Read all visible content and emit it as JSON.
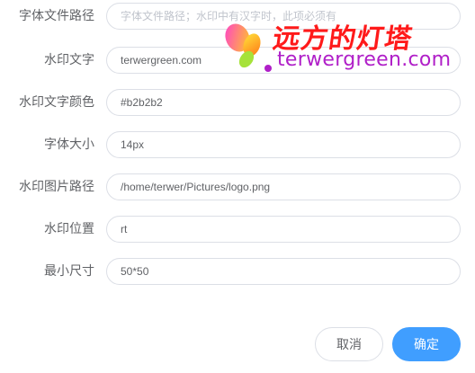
{
  "form": {
    "fields": [
      {
        "label": "字体文件路径",
        "value": "",
        "placeholder": "字体文件路径；水印中有汉字时，此项必须有"
      },
      {
        "label": "水印文字",
        "value": "terwergreen.com",
        "placeholder": ""
      },
      {
        "label": "水印文字颜色",
        "value": "#b2b2b2",
        "placeholder": ""
      },
      {
        "label": "字体大小",
        "value": "14px",
        "placeholder": ""
      },
      {
        "label": "水印图片路径",
        "value": "/home/terwer/Pictures/logo.png",
        "placeholder": ""
      },
      {
        "label": "水印位置",
        "value": "rt",
        "placeholder": ""
      },
      {
        "label": "最小尺寸",
        "value": "50*50",
        "placeholder": ""
      }
    ]
  },
  "actions": {
    "cancel_label": "取消",
    "confirm_label": "确定"
  },
  "watermark": {
    "title": "远方的灯塔",
    "subtitle": "terwergreen.com"
  },
  "colors": {
    "primary": "#409eff",
    "border": "#dcdfe6",
    "label": "#606266",
    "placeholder": "#c0c4cc",
    "watermark_title": "#ff1a1a",
    "watermark_subtitle": "#b01fc8"
  }
}
